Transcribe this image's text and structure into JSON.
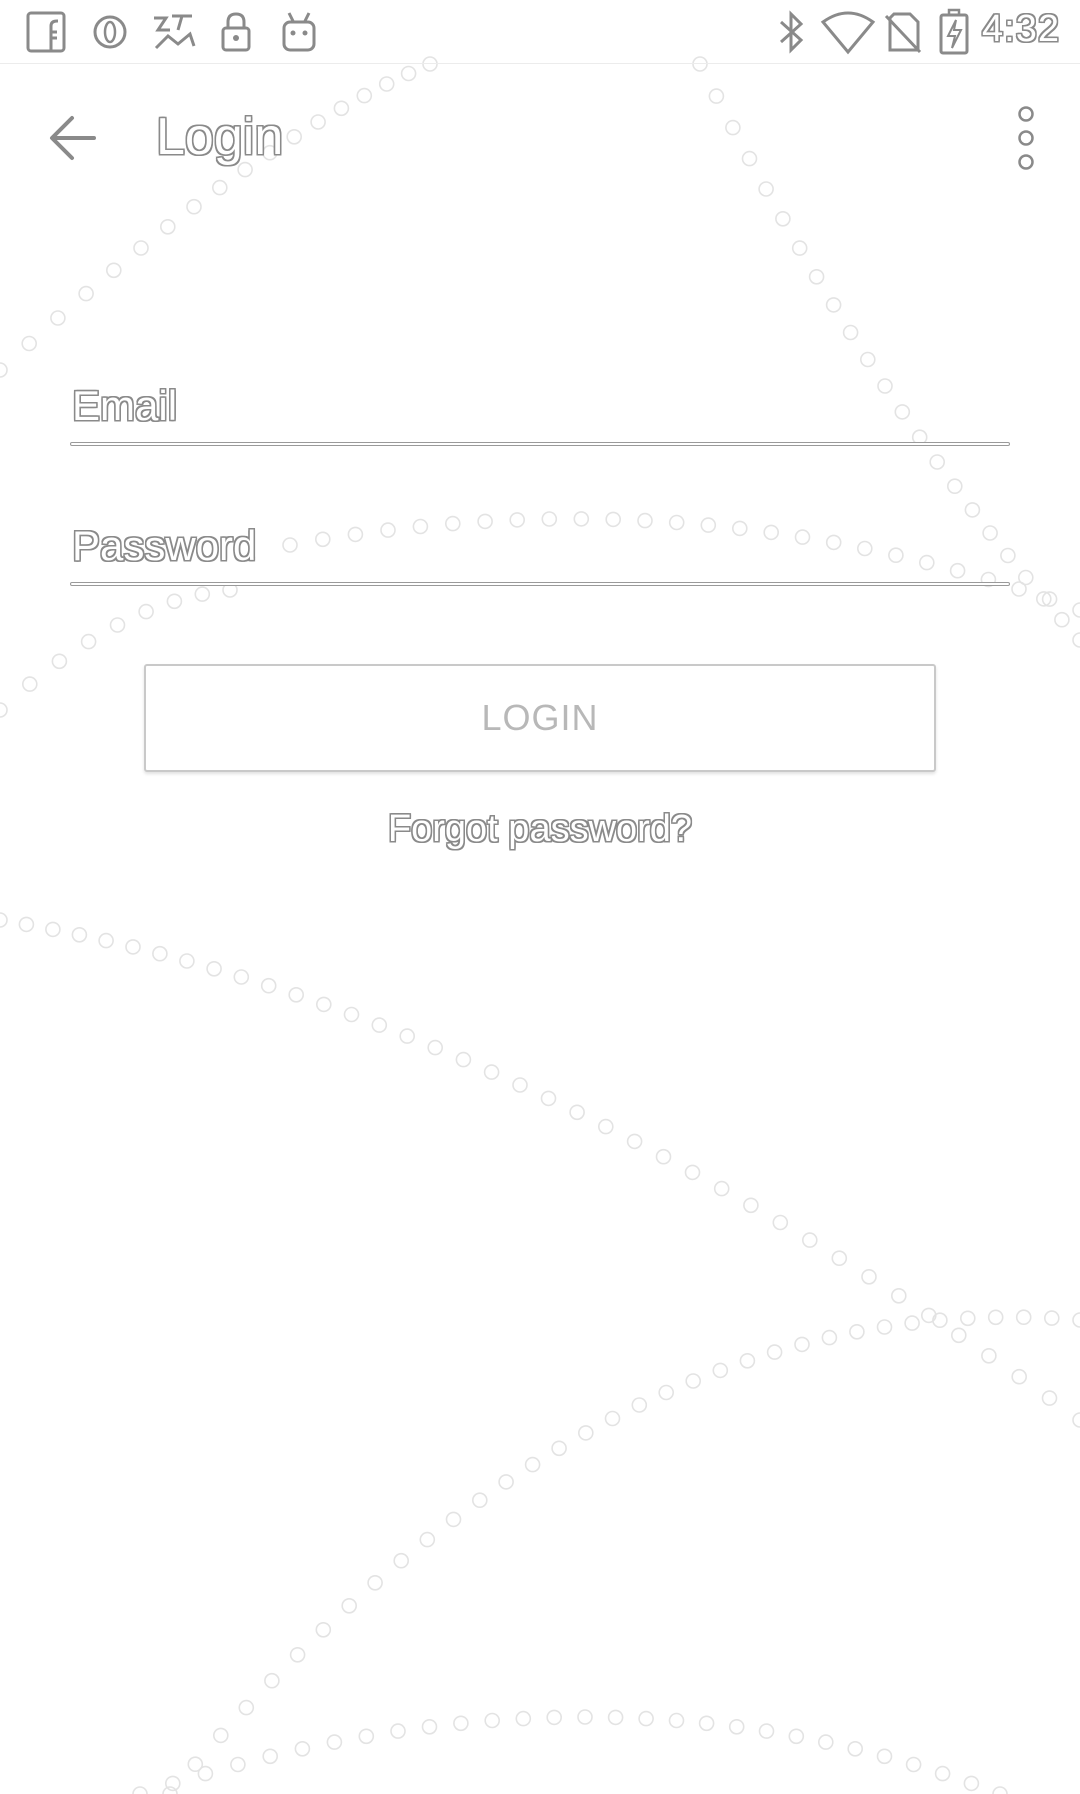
{
  "status_bar": {
    "time": "4:32",
    "left_icons": [
      "facebook-icon",
      "opera-icon",
      "app-icon",
      "lock-icon",
      "android-icon"
    ],
    "right_icons": [
      "bluetooth-icon",
      "wifi-icon",
      "no-sim-icon",
      "battery-charging-icon"
    ]
  },
  "app_bar": {
    "title": "Login"
  },
  "form": {
    "email_label": "Email",
    "password_label": "Password",
    "login_button": "LOGIN",
    "forgot_password": "Forgot password?"
  }
}
